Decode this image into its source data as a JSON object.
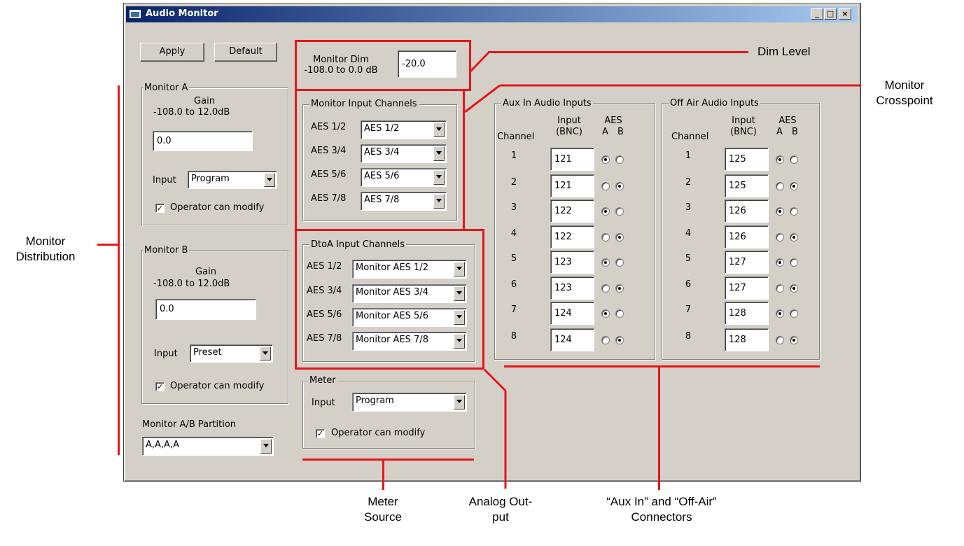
{
  "window": {
    "title": "Audio Monitor",
    "minimize_glyph": "_",
    "maximize_glyph": "□",
    "close_glyph": "×",
    "title_bar_color": "#0a246a"
  },
  "toolbar": {
    "apply_label": "Apply",
    "default_label": "Default"
  },
  "monitor_dim": {
    "label_line1": "Monitor Dim",
    "label_line2": "-108.0 to 0.0 dB",
    "value": "-20.0"
  },
  "monitor_a": {
    "group_label": "Monitor A",
    "gain_label": "Gain",
    "gain_range": "-108.0 to 12.0dB",
    "gain_value": "0.0",
    "input_label": "Input",
    "input_value": "Program",
    "operator_label": "Operator can modify",
    "operator_checked": true
  },
  "monitor_b": {
    "group_label": "Monitor B",
    "gain_label": "Gain",
    "gain_range": "-108.0 to 12.0dB",
    "gain_value": "0.0",
    "input_label": "Input",
    "input_value": "Preset",
    "operator_label": "Operator can modify",
    "operator_checked": true
  },
  "partition": {
    "label": "Monitor A/B Partition",
    "value": "A,A,A,A"
  },
  "monitor_input_channels": {
    "group_label": "Monitor Input Channels",
    "rows": [
      {
        "label": "AES 1/2",
        "value": "AES 1/2"
      },
      {
        "label": "AES 3/4",
        "value": "AES 3/4"
      },
      {
        "label": "AES 5/6",
        "value": "AES 5/6"
      },
      {
        "label": "AES 7/8",
        "value": "AES 7/8"
      }
    ]
  },
  "dtoa_input_channels": {
    "group_label": "DtoA Input Channels",
    "rows": [
      {
        "label": "AES 1/2",
        "value": "Monitor AES 1/2"
      },
      {
        "label": "AES 3/4",
        "value": "Monitor AES 3/4"
      },
      {
        "label": "AES 5/6",
        "value": "Monitor AES 5/6"
      },
      {
        "label": "AES 7/8",
        "value": "Monitor AES 7/8"
      }
    ]
  },
  "meter": {
    "group_label": "Meter",
    "input_label": "Input",
    "input_value": "Program",
    "operator_label": "Operator can modify",
    "operator_checked": true
  },
  "aux_in": {
    "group_label": "Aux In Audio Inputs",
    "col_channel": "Channel",
    "col_input_1": "Input",
    "col_input_2": "(BNC)",
    "col_aes": "AES",
    "col_a": "A",
    "col_b": "B",
    "rows": [
      {
        "channel": "1",
        "input": "121",
        "aes": "A"
      },
      {
        "channel": "2",
        "input": "121",
        "aes": "B"
      },
      {
        "channel": "3",
        "input": "122",
        "aes": "A"
      },
      {
        "channel": "4",
        "input": "122",
        "aes": "B"
      },
      {
        "channel": "5",
        "input": "123",
        "aes": "A"
      },
      {
        "channel": "6",
        "input": "123",
        "aes": "B"
      },
      {
        "channel": "7",
        "input": "124",
        "aes": "A"
      },
      {
        "channel": "8",
        "input": "124",
        "aes": "B"
      }
    ]
  },
  "off_air": {
    "group_label": "Off Air Audio Inputs",
    "col_channel": "Channel",
    "col_input_1": "Input",
    "col_input_2": "(BNC)",
    "col_aes": "AES",
    "col_a": "A",
    "col_b": "B",
    "rows": [
      {
        "channel": "1",
        "input": "125",
        "aes": "A"
      },
      {
        "channel": "2",
        "input": "125",
        "aes": "B"
      },
      {
        "channel": "3",
        "input": "126",
        "aes": "A"
      },
      {
        "channel": "4",
        "input": "126",
        "aes": "B"
      },
      {
        "channel": "5",
        "input": "127",
        "aes": "A"
      },
      {
        "channel": "6",
        "input": "127",
        "aes": "B"
      },
      {
        "channel": "7",
        "input": "128",
        "aes": "A"
      },
      {
        "channel": "8",
        "input": "128",
        "aes": "B"
      }
    ]
  },
  "callouts": {
    "dim_level": "Dim Level",
    "monitor_crosspoint_1": "Monitor",
    "monitor_crosspoint_2": "Crosspoint",
    "monitor_distribution_1": "Monitor",
    "monitor_distribution_2": "Distribution",
    "meter_source_1": "Meter",
    "meter_source_2": "Source",
    "analog_output_1": "Analog Out-",
    "analog_output_2": "put",
    "connectors_1": "“Aux In” and “Off-Air”",
    "connectors_2": "Connectors",
    "color": "#e8141b"
  }
}
